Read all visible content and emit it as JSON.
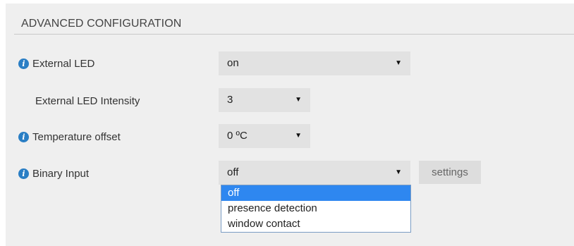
{
  "section": {
    "title": "ADVANCED CONFIGURATION"
  },
  "rows": {
    "external_led": {
      "label": "External LED",
      "value": "on",
      "has_info": true
    },
    "external_led_intensity": {
      "label": "External LED Intensity",
      "value": "3",
      "has_info": false
    },
    "temperature_offset": {
      "label": "Temperature offset",
      "value": "0 ºC",
      "has_info": true
    },
    "binary_input": {
      "label": "Binary Input",
      "value": "off",
      "has_info": true,
      "settings_label": "settings",
      "options": [
        "off",
        "presence detection",
        "window contact"
      ],
      "selected_option": "off"
    }
  },
  "icons": {
    "info": "info-icon",
    "caret": "caret-down-icon"
  },
  "colors": {
    "info_icon": "#2a7ec4",
    "dropdown_highlight": "#2e87f0",
    "panel_bg": "#efefef"
  }
}
